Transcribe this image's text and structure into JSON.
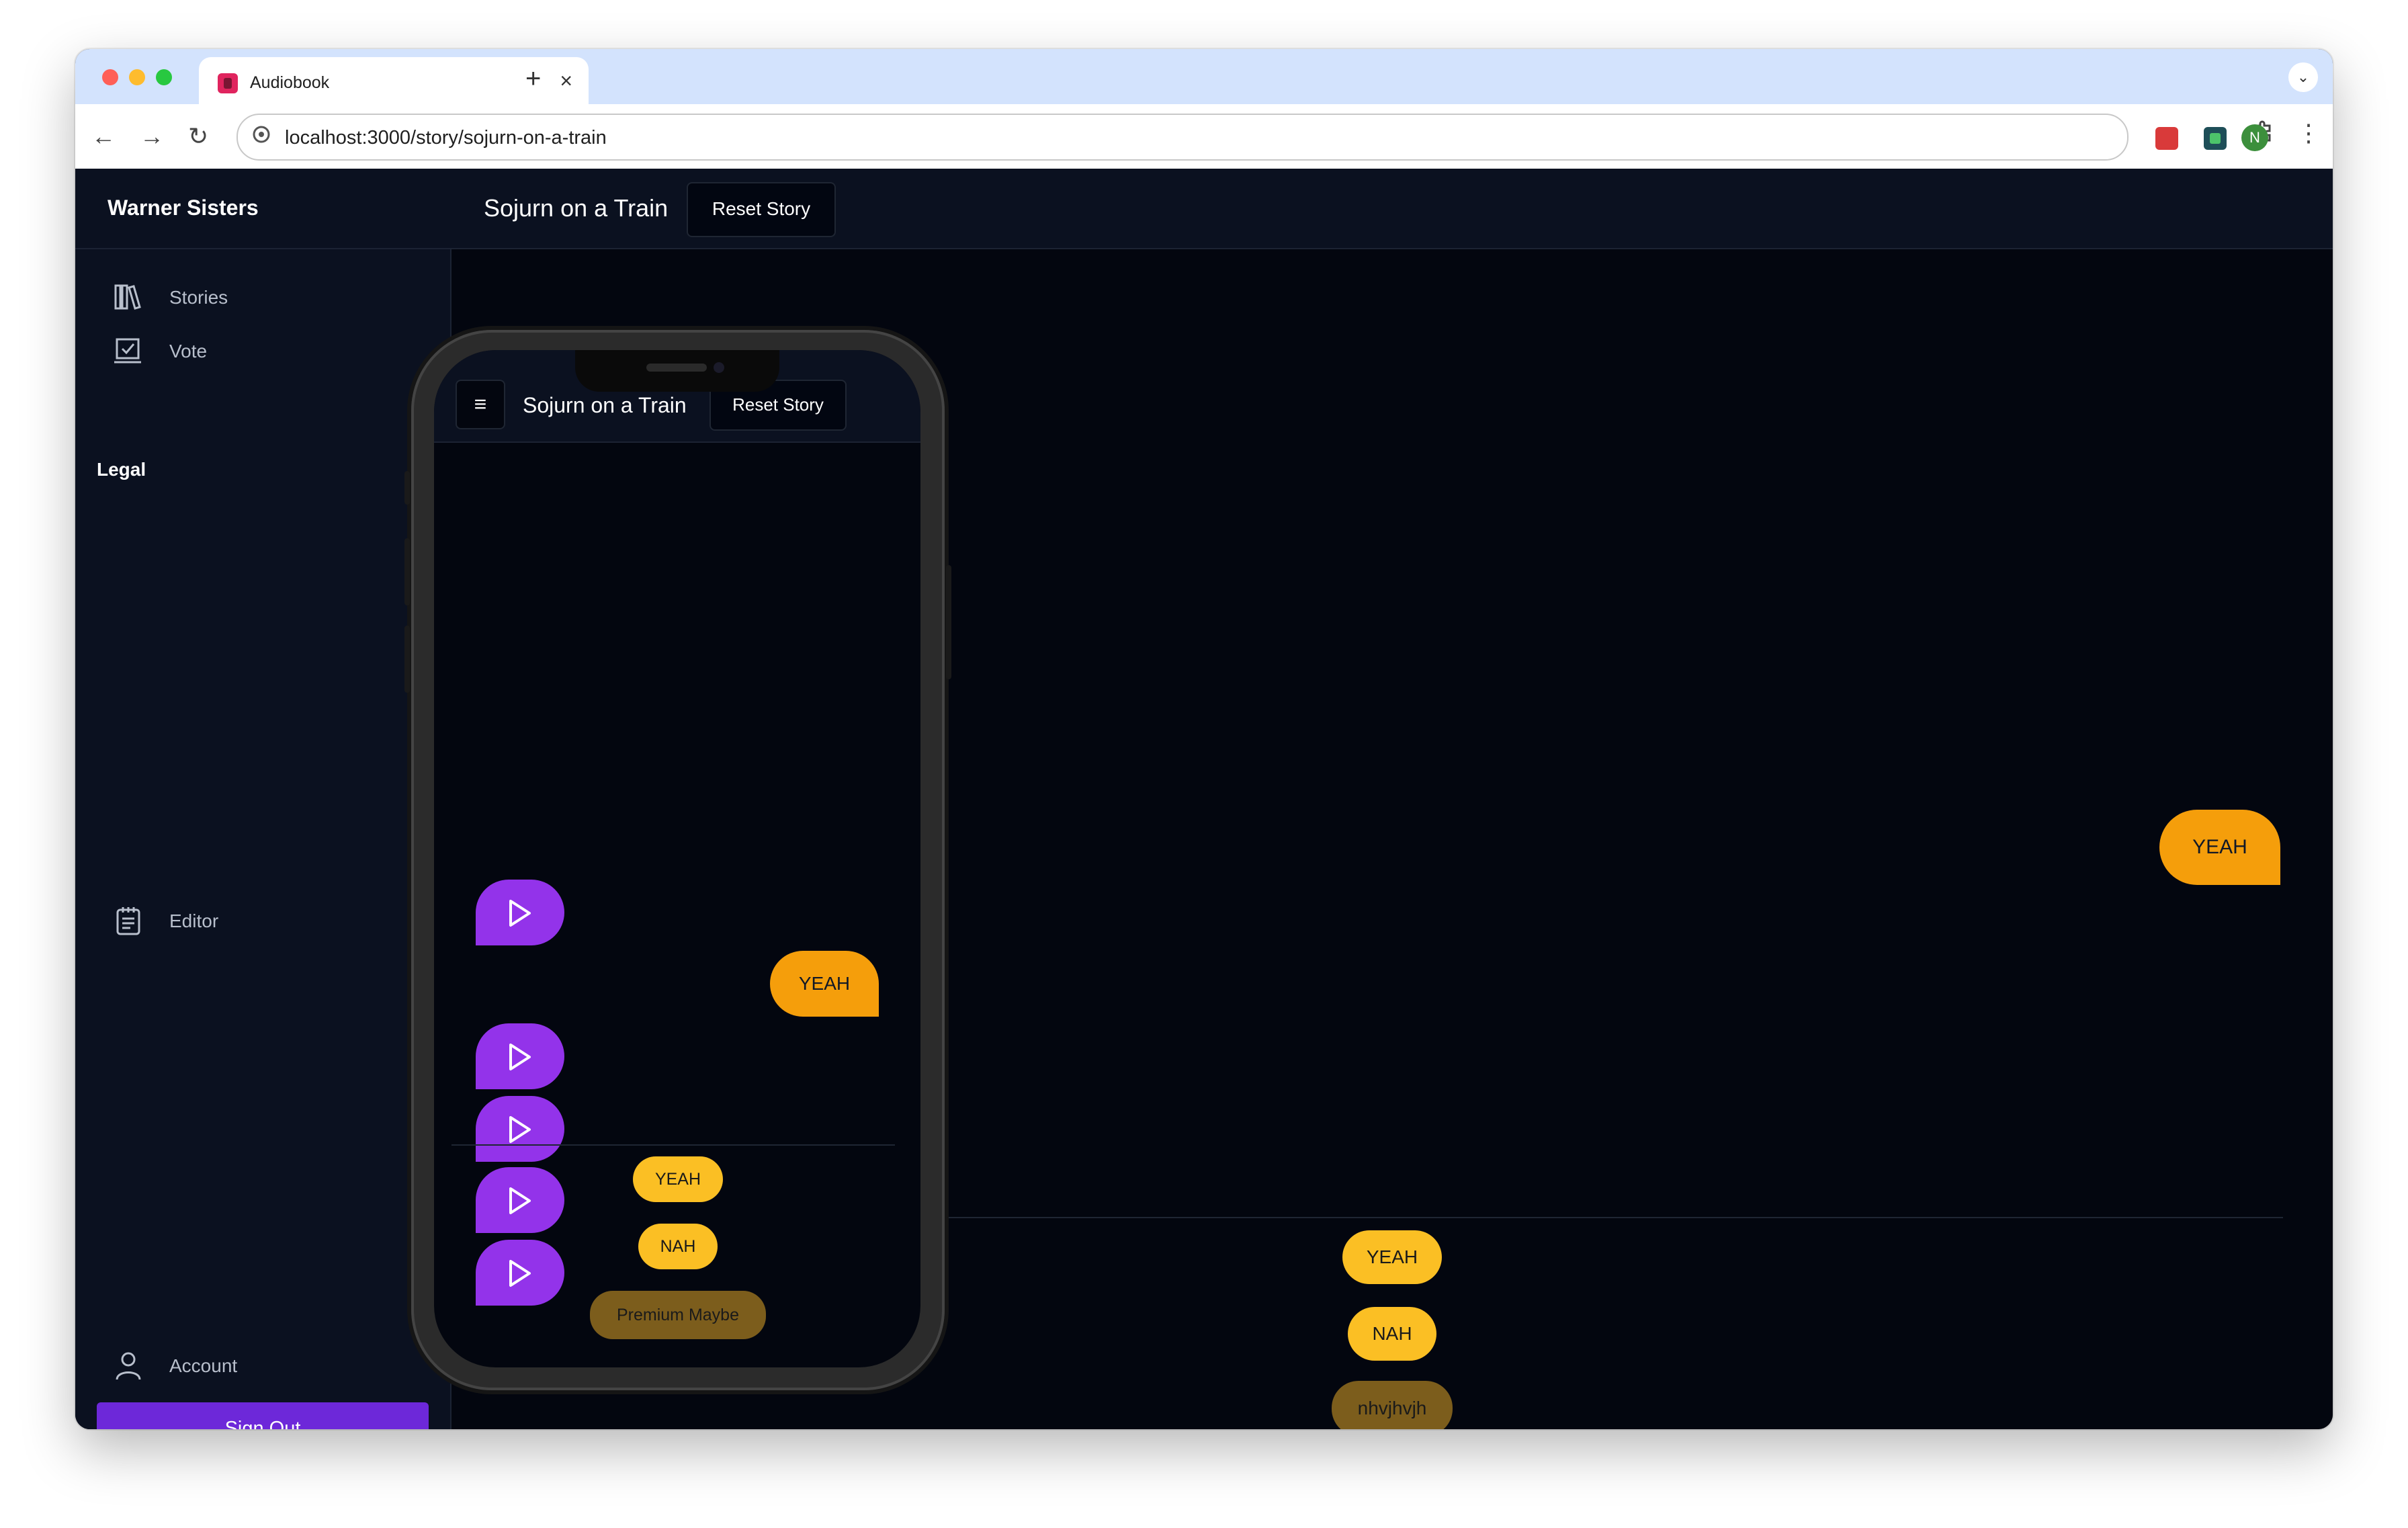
{
  "browser": {
    "tab_title": "Audiobook",
    "tab_close": "×",
    "new_tab": "+",
    "url": "localhost:3000/story/sojurn-on-a-train",
    "profile_initial": "N"
  },
  "sidebar": {
    "brand": "Warner Sisters",
    "items": [
      {
        "label": "Stories",
        "icon": "library-icon"
      },
      {
        "label": "Vote",
        "icon": "vote-box-icon"
      }
    ],
    "legal_heading": "Legal",
    "editor": {
      "label": "Editor",
      "icon": "notepad-icon"
    },
    "account": {
      "label": "Account",
      "icon": "user-icon"
    },
    "sign_out": "Sign Out"
  },
  "header": {
    "story_title": "Sojurn on a Train",
    "reset_label": "Reset Story"
  },
  "conversation": {
    "user_bubble": "YEAH"
  },
  "choices": {
    "yeah": "YEAH",
    "nah": "NAH",
    "premium": "nhvjhvjh"
  },
  "phone": {
    "menu_icon": "≡",
    "story_title": "Sojurn on a Train",
    "reset_label": "Reset Story",
    "user_bubble": "YEAH",
    "choices": {
      "yeah": "YEAH",
      "nah": "NAH",
      "premium": "Premium Maybe"
    }
  },
  "colors": {
    "accent_purple": "#9333ea",
    "sign_out_purple": "#6d28d9",
    "choice_yellow": "#fbbf24",
    "bubble_orange": "#f59e0b",
    "premium_brown": "#7c5d1c"
  }
}
